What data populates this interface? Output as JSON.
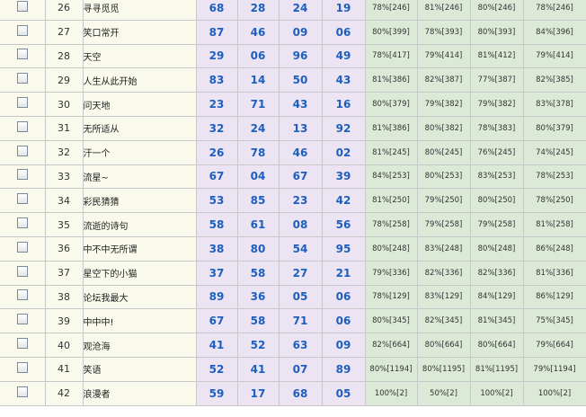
{
  "rows": [
    {
      "rank": "26",
      "name": "寻寻觅觅",
      "nums": [
        "68",
        "28",
        "24",
        "19"
      ],
      "pcts": [
        "78%[246]",
        "81%[246]",
        "80%[246]",
        "78%[246]"
      ]
    },
    {
      "rank": "27",
      "name": "笑口常开",
      "nums": [
        "87",
        "46",
        "09",
        "06"
      ],
      "pcts": [
        "80%[399]",
        "78%[393]",
        "80%[393]",
        "84%[396]"
      ]
    },
    {
      "rank": "28",
      "name": "天空",
      "nums": [
        "29",
        "06",
        "96",
        "49"
      ],
      "pcts": [
        "78%[417]",
        "79%[414]",
        "81%[412]",
        "79%[414]"
      ]
    },
    {
      "rank": "29",
      "name": "人生从此开始",
      "nums": [
        "83",
        "14",
        "50",
        "43"
      ],
      "pcts": [
        "81%[386]",
        "82%[387]",
        "77%[387]",
        "82%[385]"
      ]
    },
    {
      "rank": "30",
      "name": "问天地",
      "nums": [
        "23",
        "71",
        "43",
        "16"
      ],
      "pcts": [
        "80%[379]",
        "79%[382]",
        "79%[382]",
        "83%[378]"
      ]
    },
    {
      "rank": "31",
      "name": "无所适从",
      "nums": [
        "32",
        "24",
        "13",
        "92"
      ],
      "pcts": [
        "81%[386]",
        "80%[382]",
        "78%[383]",
        "80%[379]"
      ]
    },
    {
      "rank": "32",
      "name": "汗一个",
      "nums": [
        "26",
        "78",
        "46",
        "02"
      ],
      "pcts": [
        "81%[245]",
        "80%[245]",
        "76%[245]",
        "74%[245]"
      ]
    },
    {
      "rank": "33",
      "name": "流星~",
      "nums": [
        "67",
        "04",
        "67",
        "39"
      ],
      "pcts": [
        "84%[253]",
        "80%[253]",
        "83%[253]",
        "78%[253]"
      ]
    },
    {
      "rank": "34",
      "name": "彩民猜猜",
      "nums": [
        "53",
        "85",
        "23",
        "42"
      ],
      "pcts": [
        "81%[250]",
        "79%[250]",
        "80%[250]",
        "78%[250]"
      ]
    },
    {
      "rank": "35",
      "name": "流逝的诗句",
      "nums": [
        "58",
        "61",
        "08",
        "56"
      ],
      "pcts": [
        "78%[258]",
        "79%[258]",
        "79%[258]",
        "81%[258]"
      ]
    },
    {
      "rank": "36",
      "name": "中不中无所谓",
      "nums": [
        "38",
        "80",
        "54",
        "95"
      ],
      "pcts": [
        "80%[248]",
        "83%[248]",
        "80%[248]",
        "86%[248]"
      ]
    },
    {
      "rank": "37",
      "name": "星空下的小猫",
      "nums": [
        "37",
        "58",
        "27",
        "21"
      ],
      "pcts": [
        "79%[336]",
        "82%[336]",
        "82%[336]",
        "81%[336]"
      ]
    },
    {
      "rank": "38",
      "name": "论坛我最大",
      "nums": [
        "89",
        "36",
        "05",
        "06"
      ],
      "pcts": [
        "78%[129]",
        "83%[129]",
        "84%[129]",
        "86%[129]"
      ]
    },
    {
      "rank": "39",
      "name": "中中中!",
      "nums": [
        "67",
        "58",
        "71",
        "06"
      ],
      "pcts": [
        "80%[345]",
        "82%[345]",
        "81%[345]",
        "75%[345]"
      ]
    },
    {
      "rank": "40",
      "name": "观沧海",
      "nums": [
        "41",
        "52",
        "63",
        "09"
      ],
      "pcts": [
        "82%[664]",
        "80%[664]",
        "80%[664]",
        "79%[664]"
      ]
    },
    {
      "rank": "41",
      "name": "笑语",
      "nums": [
        "52",
        "41",
        "07",
        "89"
      ],
      "pcts": [
        "80%[1194]",
        "80%[1195]",
        "81%[1195]",
        "79%[1194]"
      ]
    },
    {
      "rank": "42",
      "name": "浪漫者",
      "nums": [
        "59",
        "17",
        "68",
        "05"
      ],
      "pcts": [
        "100%[2]",
        "50%[2]",
        "100%[2]",
        "100%[2]"
      ]
    }
  ]
}
